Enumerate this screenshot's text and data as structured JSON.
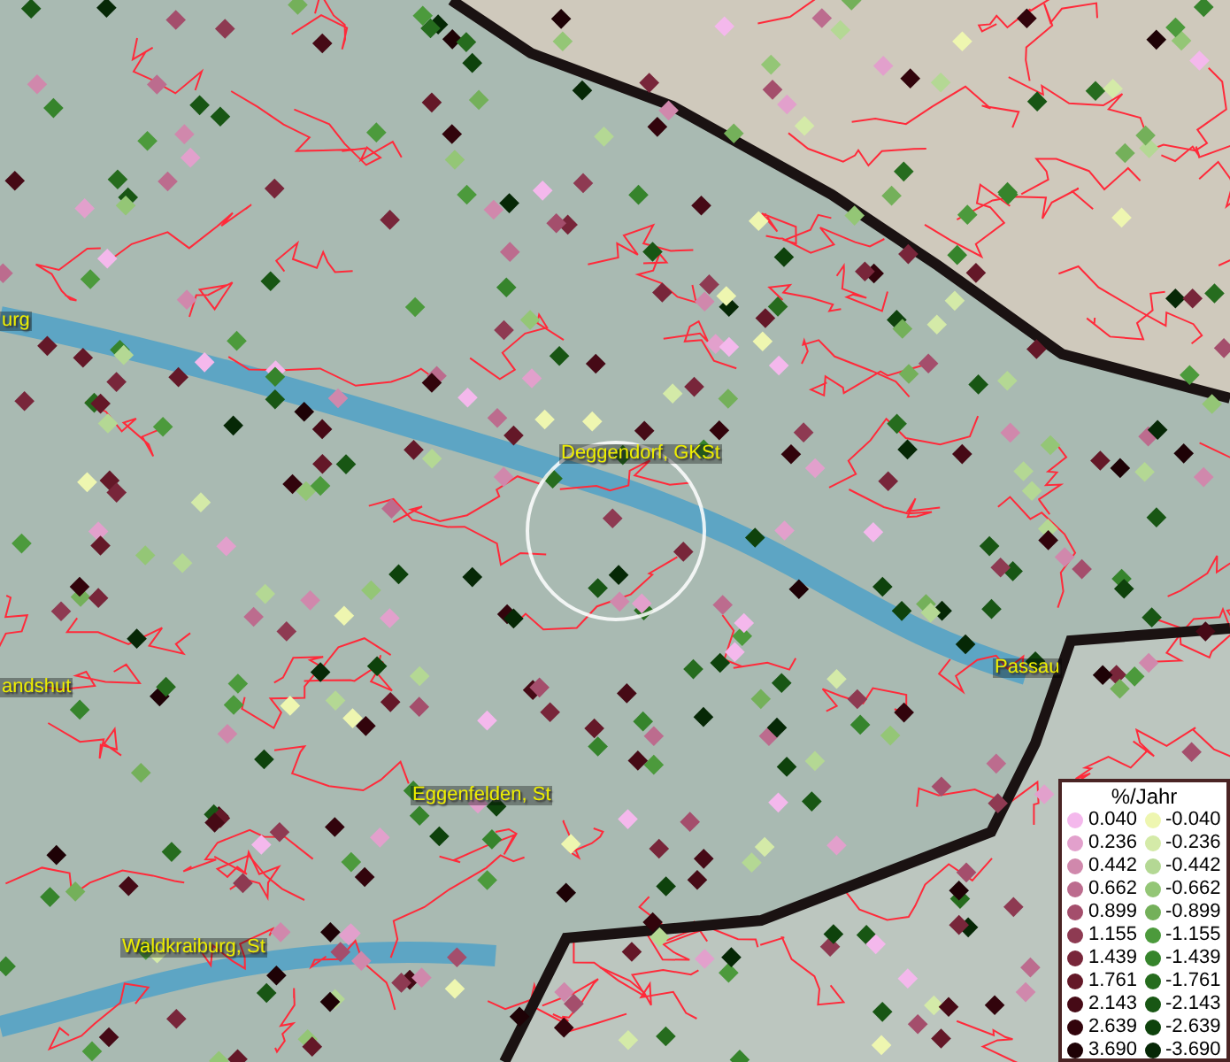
{
  "map_labels": [
    {
      "text": "urg"
    },
    {
      "text": "Deggendorf, GKSt"
    },
    {
      "text": "andshut"
    },
    {
      "text": "Passau"
    },
    {
      "text": "Eggenfelden, St"
    },
    {
      "text": "Waldkraiburg, St"
    }
  ],
  "legend": {
    "title": "%/Jahr",
    "positive": [
      {
        "value": "0.040",
        "color": "#f4b8ec"
      },
      {
        "value": "0.236",
        "color": "#e2a0cc"
      },
      {
        "value": "0.442",
        "color": "#d088ac"
      },
      {
        "value": "0.662",
        "color": "#bc6c8e"
      },
      {
        "value": "0.899",
        "color": "#a44e6c"
      },
      {
        "value": "1.155",
        "color": "#8e3a52"
      },
      {
        "value": "1.439",
        "color": "#78263a"
      },
      {
        "value": "1.761",
        "color": "#641828"
      },
      {
        "value": "2.143",
        "color": "#460a16"
      },
      {
        "value": "2.639",
        "color": "#32040c"
      },
      {
        "value": "3.690",
        "color": "#1e0206"
      }
    ],
    "negative": [
      {
        "value": "-0.040",
        "color": "#eef6b0"
      },
      {
        "value": "-0.236",
        "color": "#d4eaa8"
      },
      {
        "value": "-0.442",
        "color": "#b4d894"
      },
      {
        "value": "-0.662",
        "color": "#94c676"
      },
      {
        "value": "-0.899",
        "color": "#74b05a"
      },
      {
        "value": "-1.155",
        "color": "#4c9a3c"
      },
      {
        "value": "-1.439",
        "color": "#36842c"
      },
      {
        "value": "-1.761",
        "color": "#266c1e"
      },
      {
        "value": "-2.143",
        "color": "#185614"
      },
      {
        "value": "-2.639",
        "color": "#0e420c"
      },
      {
        "value": "-3.690",
        "color": "#062806"
      }
    ]
  }
}
